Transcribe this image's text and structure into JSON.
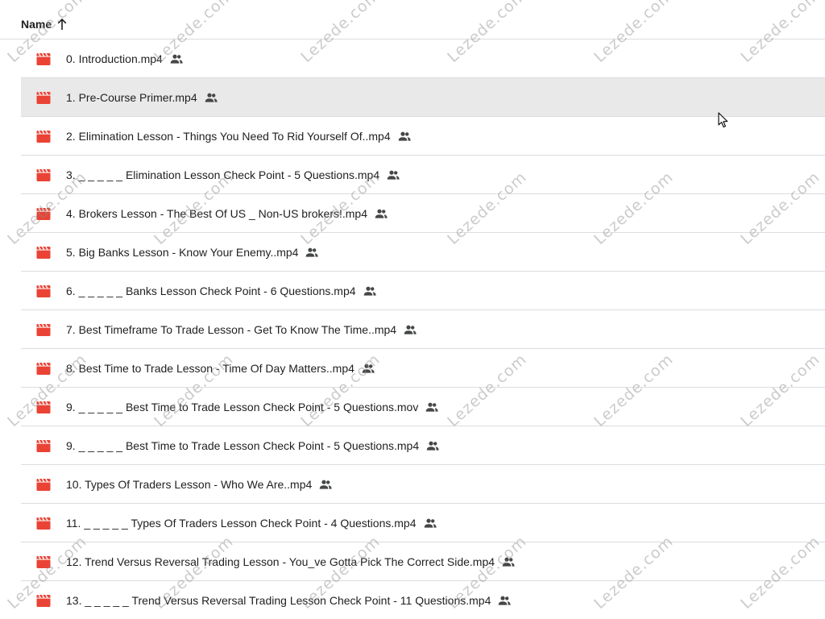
{
  "header": {
    "name_label": "Name",
    "sort_icon": "arrow-up-icon"
  },
  "files": [
    {
      "name": "0. Introduction.mp4",
      "icon": "video-file-icon",
      "shared": true
    },
    {
      "name": "1. Pre-Course Primer.mp4",
      "icon": "video-file-icon",
      "shared": true,
      "hovered": true
    },
    {
      "name": "2. Elimination Lesson - Things You Need To Rid Yourself Of..mp4",
      "icon": "video-file-icon",
      "shared": true
    },
    {
      "name": "3. _ _ _ _ _ Elimination Lesson Check Point - 5 Questions.mp4",
      "icon": "video-file-icon",
      "shared": true
    },
    {
      "name": "4. Brokers Lesson - The Best Of US _ Non-US brokers!.mp4",
      "icon": "video-file-icon",
      "shared": true
    },
    {
      "name": "5. Big Banks Lesson - Know Your Enemy..mp4",
      "icon": "video-file-icon",
      "shared": true
    },
    {
      "name": "6. _ _ _ _ _ Banks Lesson Check Point - 6 Questions.mp4",
      "icon": "video-file-icon",
      "shared": true
    },
    {
      "name": "7. Best Timeframe To Trade Lesson - Get To Know The Time..mp4",
      "icon": "video-file-icon",
      "shared": true
    },
    {
      "name": "8. Best Time to Trade Lesson - Time Of Day Matters..mp4",
      "icon": "video-file-icon",
      "shared": true
    },
    {
      "name": "9. _ _ _ _ _ Best Time to Trade Lesson Check Point - 5 Questions.mov",
      "icon": "video-file-icon",
      "shared": true
    },
    {
      "name": "9. _ _ _ _ _ Best Time to Trade Lesson Check Point - 5 Questions.mp4",
      "icon": "video-file-icon",
      "shared": true
    },
    {
      "name": "10. Types Of Traders Lesson - Who We Are..mp4",
      "icon": "video-file-icon",
      "shared": true
    },
    {
      "name": "11. _ _ _ _ _ Types Of Traders Lesson Check Point - 4 Questions.mp4",
      "icon": "video-file-icon",
      "shared": true
    },
    {
      "name": "12. Trend Versus Reversal Trading Lesson - You_ve Gotta Pick The Correct Side.mp4",
      "icon": "video-file-icon",
      "shared": true
    },
    {
      "name": "13. _ _ _ _ _ Trend Versus Reversal Trading Lesson Check Point - 11 Questions.mp4",
      "icon": "video-file-icon",
      "shared": true
    }
  ],
  "watermark": {
    "text": "Lezede.com"
  },
  "colors": {
    "video_icon": "#ea4335",
    "divider": "#dadce0",
    "hover_row": "#e9e9e9",
    "text": "#1f1f1f",
    "icon_gray": "#444746"
  }
}
